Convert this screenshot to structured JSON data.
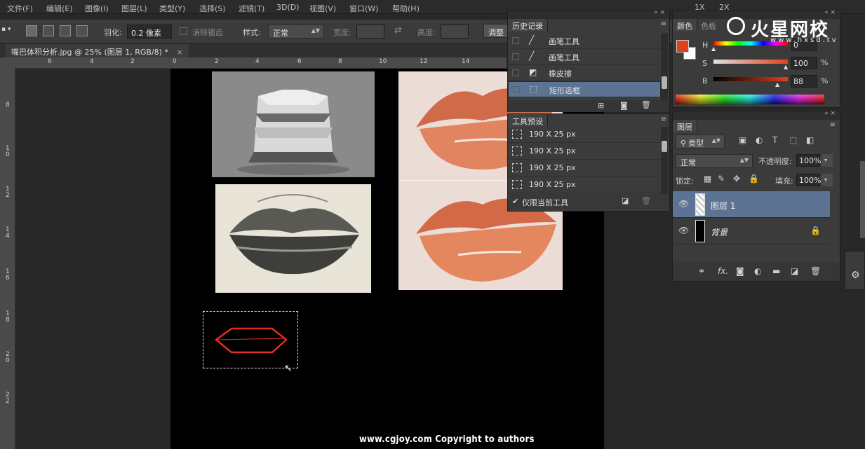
{
  "menu": [
    "文件(F)",
    "编辑(E)",
    "图像(I)",
    "图层(L)",
    "类型(Y)",
    "选择(S)",
    "滤镜(T)",
    "3D(D)",
    "视图(V)",
    "窗口(W)",
    "帮助(H)"
  ],
  "menu_right": [
    "1X",
    "2X"
  ],
  "options": {
    "feather_label": "羽化:",
    "feather_value": "0.2 像素",
    "antialias_label": "消除锯齿",
    "style_label": "样式:",
    "style_value": "正常",
    "width_label": "宽度:",
    "height_label": "高度:",
    "refine_button": "调整"
  },
  "document": {
    "tab_title": "嘴巴体积分析.jpg @ 25% (图层 1, RGB/8) *",
    "close": "×"
  },
  "ruler": {
    "h_ticks": [
      "6",
      "4",
      "2",
      "0",
      "2",
      "4",
      "6",
      "8",
      "10",
      "12",
      "14",
      "16"
    ],
    "v_ticks": [
      "8",
      "1\n0",
      "1\n2",
      "1\n4",
      "1\n6",
      "1\n8",
      "2\n0",
      "2\n2"
    ]
  },
  "history": {
    "title": "历史记录",
    "items": [
      {
        "label": "画笔工具",
        "icon": "brush-icon",
        "selected": false
      },
      {
        "label": "画笔工具",
        "icon": "brush-icon",
        "selected": false
      },
      {
        "label": "橡皮擦",
        "icon": "eraser-icon",
        "selected": false
      },
      {
        "label": "矩形选框",
        "icon": "marquee-icon",
        "selected": true
      }
    ]
  },
  "presets": {
    "title": "工具预设",
    "items": [
      "190 X 25 px",
      "190 X 25 px",
      "190 X 25 px",
      "190 X 25 px"
    ],
    "current_only_label": "仅限当前工具"
  },
  "color": {
    "tab_color": "颜色",
    "tab_swatches": "色板",
    "h_label": "H",
    "s_label": "S",
    "b_label": "B",
    "h_value": "0",
    "s_value": "100",
    "b_value": "88",
    "percent": "%",
    "foreground": "#e0401a",
    "background": "#ffffff"
  },
  "layers": {
    "title": "图层",
    "filter_label": "类型",
    "blend_mode": "正常",
    "opacity_label": "不透明度:",
    "opacity_value": "100%",
    "lock_label": "锁定:",
    "fill_label": "填充:",
    "fill_value": "100%",
    "items": [
      {
        "name": "图层 1",
        "selected": true
      },
      {
        "name": "背景",
        "selected": false,
        "locked": true
      }
    ]
  },
  "logo": {
    "text": "火星网校",
    "sub": "www.hxsd.tv"
  },
  "watermark": "www.cgjoy.com Copyright to authors",
  "accent": "#5d7394"
}
